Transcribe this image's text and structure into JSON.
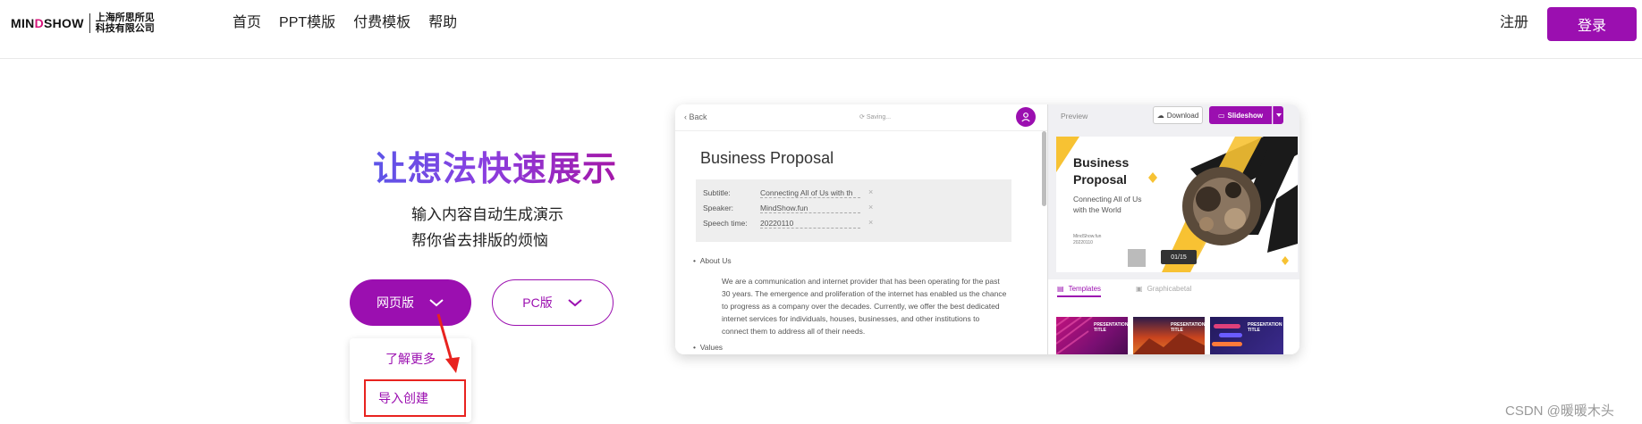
{
  "header": {
    "logo": {
      "word": "MINDSHOW",
      "company_line1": "上海所思所见",
      "company_line2": "科技有限公司"
    },
    "nav": [
      {
        "label": "首页"
      },
      {
        "label": "PPT模版"
      },
      {
        "label": "付费模板"
      },
      {
        "label": "帮助"
      }
    ],
    "register_label": "注册",
    "login_label": "登录"
  },
  "hero": {
    "title": "让想法快速展示",
    "subtitle_line1": "输入内容自动生成演示",
    "subtitle_line2": "帮你省去排版的烦恼",
    "web_button": "网页版",
    "pc_button": "PC版",
    "dropdown": {
      "item1": "了解更多",
      "item2": "导入创建"
    }
  },
  "product_shot": {
    "editor": {
      "back_label": "Back",
      "saving_label": "Saving...",
      "doc_title": "Business Proposal",
      "fields": [
        {
          "label": "Subtitle:",
          "value": "Connecting All of Us with th"
        },
        {
          "label": "Speaker:",
          "value": "MindShow.fun"
        },
        {
          "label": "Speech time:",
          "value": "20220110"
        }
      ],
      "section1": "About Us",
      "bullet": "We are a communication and internet provider that has been operating for the past 30 years. The emergence and proliferation of the internet has enabled us the chance to progress as a company over the decades. Currently, we offer the best dedicated internet services for individuals, houses, businesses, and other institutions to connect them to address all of their needs.",
      "section2": "Values"
    },
    "preview": {
      "label": "Preview",
      "download_label": "Download",
      "slideshow_label": "Slideshow",
      "slide_title_line1": "Business",
      "slide_title_line2": "Proposal",
      "slide_subtitle": "Connecting All of Us with the World",
      "slide_small_line1": "MindShow.fun",
      "slide_small_line2": "20220110",
      "page_indicator": "01/15",
      "tab_templates": "Templates",
      "tab_graphics": "Graphicabetal",
      "thumb_label": "PRESENTATION TITLE"
    }
  },
  "watermark": "CSDN @暖暖木头",
  "colors": {
    "brand": "#9b0fb0",
    "highlight": "#e8231f",
    "slide_yellow": "#f7c233"
  }
}
